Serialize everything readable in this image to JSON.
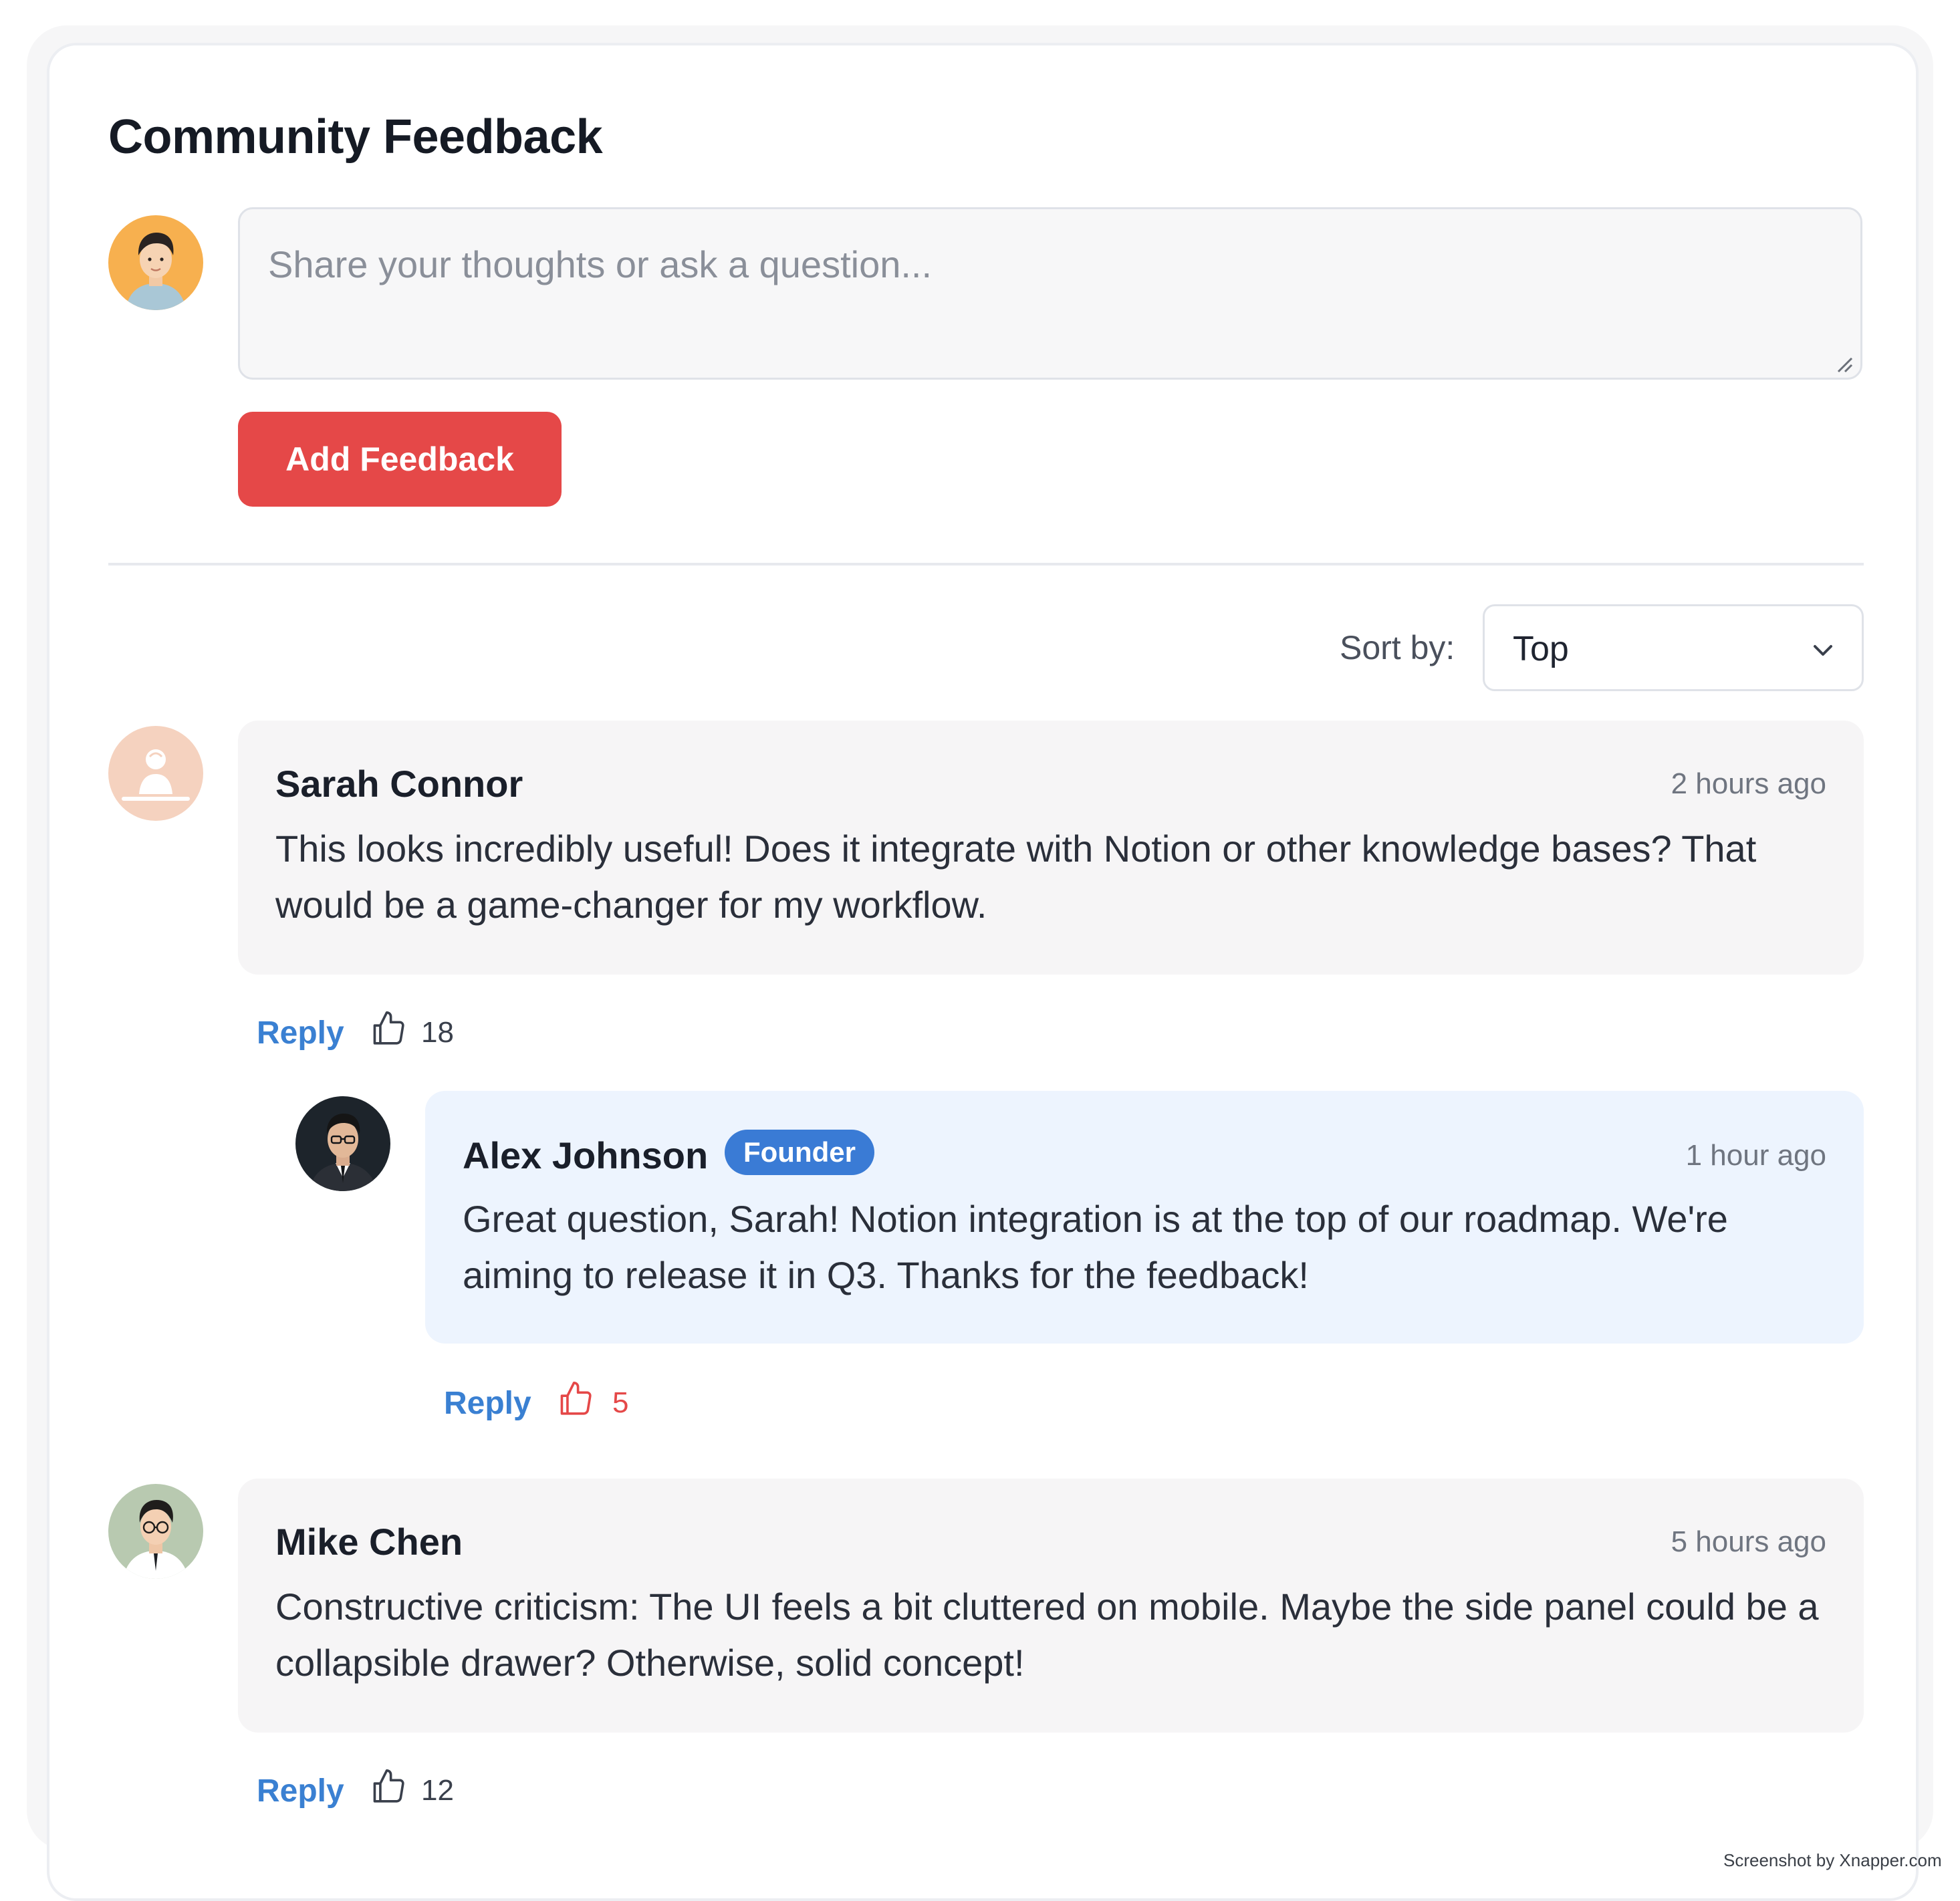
{
  "title": "Community Feedback",
  "composer": {
    "placeholder": "Share your thoughts or ask a question...",
    "submit_label": "Add Feedback"
  },
  "sort": {
    "label": "Sort by:",
    "selected": "Top"
  },
  "comments": [
    {
      "author": "Sarah Connor",
      "time": "2 hours ago",
      "text": "This looks incredibly useful! Does it integrate with Notion or other knowledge bases? That would be a game-changer for my workflow.",
      "reply_label": "Reply",
      "likes": "18",
      "replies": [
        {
          "author": "Alex Johnson",
          "badge": "Founder",
          "time": "1 hour ago",
          "text": "Great question, Sarah! Notion integration is at the top of our roadmap. We're aiming to release it in Q3. Thanks for the feedback!",
          "reply_label": "Reply",
          "likes": "5",
          "liked": true
        }
      ]
    },
    {
      "author": "Mike Chen",
      "time": "5 hours ago",
      "text": "Constructive criticism: The UI feels a bit cluttered on mobile. Maybe the side panel could be a collapsible drawer? Otherwise, solid concept!",
      "reply_label": "Reply",
      "likes": "12"
    }
  ],
  "colors": {
    "accent": "#e54848",
    "link": "#3a80d2",
    "badge": "#3a7bd5",
    "founder_bubble": "#edf4fe",
    "bubble": "#f6f5f6"
  },
  "watermark": "Screenshot by Xnapper.com"
}
